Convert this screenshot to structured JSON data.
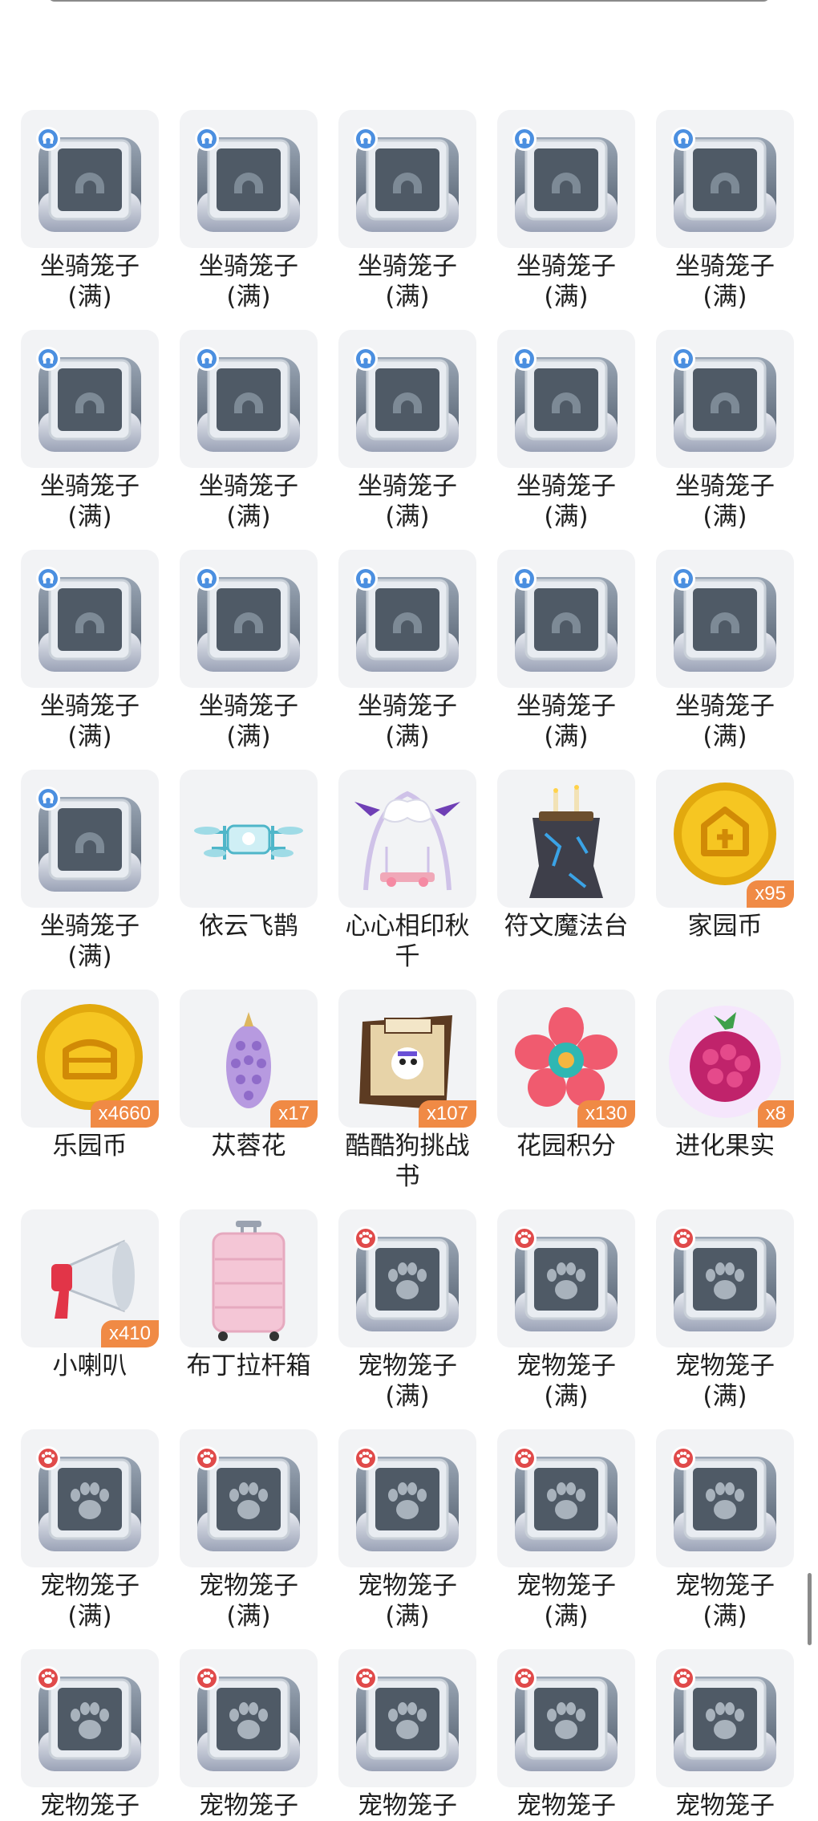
{
  "top_row_labels": [
    {
      "line1": "坐骑笼子",
      "line2": "(满)"
    },
    {
      "line1": "坐骑笼子",
      "line2": "(满)"
    },
    {
      "line1": "坐骑笼子",
      "line2": "(满)"
    },
    {
      "line1": "坐骑笼子",
      "line2": "(满)"
    },
    {
      "line1": "坐骑笼子",
      "line2": "(满)"
    }
  ],
  "rows": [
    [
      {
        "kind": "mount-cage",
        "line1": "坐骑笼子",
        "line2": "(满)",
        "qty": ""
      },
      {
        "kind": "mount-cage",
        "line1": "坐骑笼子",
        "line2": "(满)",
        "qty": ""
      },
      {
        "kind": "mount-cage",
        "line1": "坐骑笼子",
        "line2": "(满)",
        "qty": ""
      },
      {
        "kind": "mount-cage",
        "line1": "坐骑笼子",
        "line2": "(满)",
        "qty": ""
      },
      {
        "kind": "mount-cage",
        "line1": "坐骑笼子",
        "line2": "(满)",
        "qty": ""
      }
    ],
    [
      {
        "kind": "mount-cage",
        "line1": "坐骑笼子",
        "line2": "(满)",
        "qty": ""
      },
      {
        "kind": "mount-cage",
        "line1": "坐骑笼子",
        "line2": "(满)",
        "qty": ""
      },
      {
        "kind": "mount-cage",
        "line1": "坐骑笼子",
        "line2": "(满)",
        "qty": ""
      },
      {
        "kind": "mount-cage",
        "line1": "坐骑笼子",
        "line2": "(满)",
        "qty": ""
      },
      {
        "kind": "mount-cage",
        "line1": "坐骑笼子",
        "line2": "(满)",
        "qty": ""
      }
    ],
    [
      {
        "kind": "mount-cage",
        "line1": "坐骑笼子",
        "line2": "(满)",
        "qty": ""
      },
      {
        "kind": "mount-cage",
        "line1": "坐骑笼子",
        "line2": "(满)",
        "qty": ""
      },
      {
        "kind": "mount-cage",
        "line1": "坐骑笼子",
        "line2": "(满)",
        "qty": ""
      },
      {
        "kind": "mount-cage",
        "line1": "坐骑笼子",
        "line2": "(满)",
        "qty": ""
      },
      {
        "kind": "mount-cage",
        "line1": "坐骑笼子",
        "line2": "(满)",
        "qty": ""
      }
    ],
    [
      {
        "kind": "mount-cage",
        "line1": "坐骑笼子",
        "line2": "(满)",
        "qty": ""
      },
      {
        "kind": "drone",
        "line1": "依云飞鹊",
        "line2": "",
        "qty": ""
      },
      {
        "kind": "swing",
        "line1": "心心相印秋",
        "line2": "千",
        "qty": ""
      },
      {
        "kind": "rune-altar",
        "line1": "符文魔法台",
        "line2": "",
        "qty": ""
      },
      {
        "kind": "home-coin",
        "line1": "家园币",
        "line2": "",
        "qty": "x95"
      }
    ],
    [
      {
        "kind": "park-coin",
        "line1": "乐园币",
        "line2": "",
        "qty": "x4660"
      },
      {
        "kind": "flower-cone",
        "line1": "苁蓉花",
        "line2": "",
        "qty": "x17"
      },
      {
        "kind": "wanted-poster",
        "line1": "酷酷狗挑战",
        "line2": "书",
        "qty": "x107"
      },
      {
        "kind": "garden-points",
        "line1": "花园积分",
        "line2": "",
        "qty": "x130"
      },
      {
        "kind": "evolution-fruit",
        "line1": "进化果实",
        "line2": "",
        "qty": "x8"
      }
    ],
    [
      {
        "kind": "megaphone",
        "line1": "小喇叭",
        "line2": "",
        "qty": "x410"
      },
      {
        "kind": "suitcase",
        "line1": "布丁拉杆箱",
        "line2": "",
        "qty": ""
      },
      {
        "kind": "pet-cage",
        "line1": "宠物笼子",
        "line2": "(满)",
        "qty": ""
      },
      {
        "kind": "pet-cage",
        "line1": "宠物笼子",
        "line2": "(满)",
        "qty": ""
      },
      {
        "kind": "pet-cage",
        "line1": "宠物笼子",
        "line2": "(满)",
        "qty": ""
      }
    ],
    [
      {
        "kind": "pet-cage",
        "line1": "宠物笼子",
        "line2": "(满)",
        "qty": ""
      },
      {
        "kind": "pet-cage",
        "line1": "宠物笼子",
        "line2": "(满)",
        "qty": ""
      },
      {
        "kind": "pet-cage",
        "line1": "宠物笼子",
        "line2": "(满)",
        "qty": ""
      },
      {
        "kind": "pet-cage",
        "line1": "宠物笼子",
        "line2": "(满)",
        "qty": ""
      },
      {
        "kind": "pet-cage",
        "line1": "宠物笼子",
        "line2": "(满)",
        "qty": ""
      }
    ],
    [
      {
        "kind": "pet-cage",
        "line1": "宠物笼子",
        "line2": "",
        "qty": ""
      },
      {
        "kind": "pet-cage",
        "line1": "宠物笼子",
        "line2": "",
        "qty": ""
      },
      {
        "kind": "pet-cage",
        "line1": "宠物笼子",
        "line2": "",
        "qty": ""
      },
      {
        "kind": "pet-cage",
        "line1": "宠物笼子",
        "line2": "",
        "qty": ""
      },
      {
        "kind": "pet-cage",
        "line1": "宠物笼子",
        "line2": "",
        "qty": ""
      }
    ]
  ],
  "colors": {
    "tile_bg": "#f2f3f5",
    "qty_badge": "#f08a45",
    "mount_badge": "#4b8fe0",
    "pet_badge": "#e04a4a"
  }
}
